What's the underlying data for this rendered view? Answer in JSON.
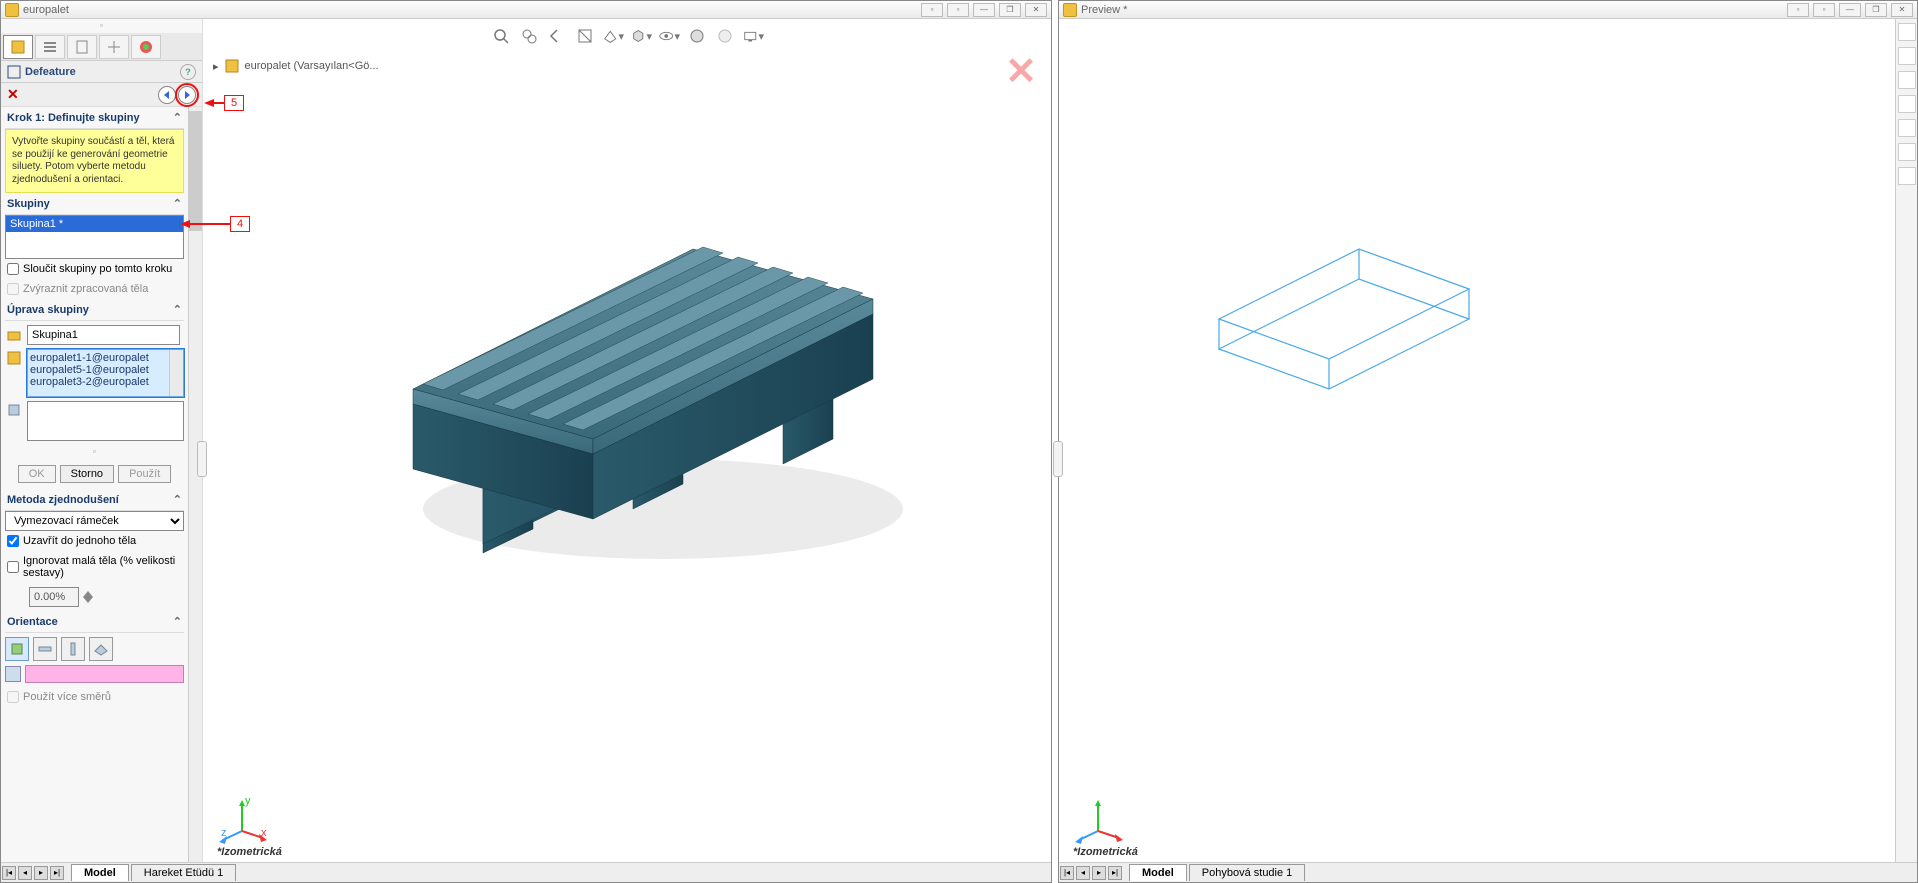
{
  "windows": {
    "main": {
      "title": "europalet"
    },
    "preview": {
      "title": "Preview *"
    }
  },
  "winbtns": [
    "▫",
    "▫",
    "—",
    "❐",
    "✕"
  ],
  "propPanel": {
    "featureTitle": "Defeature",
    "step1": {
      "title": "Krok 1: Definujte skupiny",
      "help": "Vytvořte skupiny součástí a těl, která se použijí ke generování geometrie siluety. Potom vyberte metodu zjednodušení a orientaci."
    },
    "groups": {
      "title": "Skupiny",
      "selected": "Skupina1 *",
      "mergeLabel": "Sloučit skupiny po tomto kroku",
      "highlightLabel": "Zvýraznit zpracovaná těla"
    },
    "groupEdit": {
      "title": "Úprava skupiny",
      "name": "Skupina1",
      "components": [
        "europalet1-1@europalet",
        "europalet5-1@europalet",
        "europalet3-2@europalet"
      ],
      "okLabel": "OK",
      "cancelLabel": "Storno",
      "applyLabel": "Použít"
    },
    "method": {
      "title": "Metoda zjednodušení",
      "option": "Vymezovací rámeček",
      "closeLabel": "Uzavřít do jednoho těla",
      "ignoreLabel": "Ignorovat malá těla (% velikosti sestavy)",
      "percent": "0.00%"
    },
    "orient": {
      "title": "Orientace",
      "useMoreLabel": "Použít více směrů"
    }
  },
  "breadcrumb": {
    "text": "europalet  (Varsayılan<Gö..."
  },
  "viewLabel": "*Izometrická",
  "bottomTabs": {
    "left": [
      "Model",
      "Hareket Etüdü 1"
    ],
    "right": [
      "Model",
      "Pohybová studie 1"
    ]
  },
  "annotations": {
    "four": "4",
    "five": "5"
  }
}
